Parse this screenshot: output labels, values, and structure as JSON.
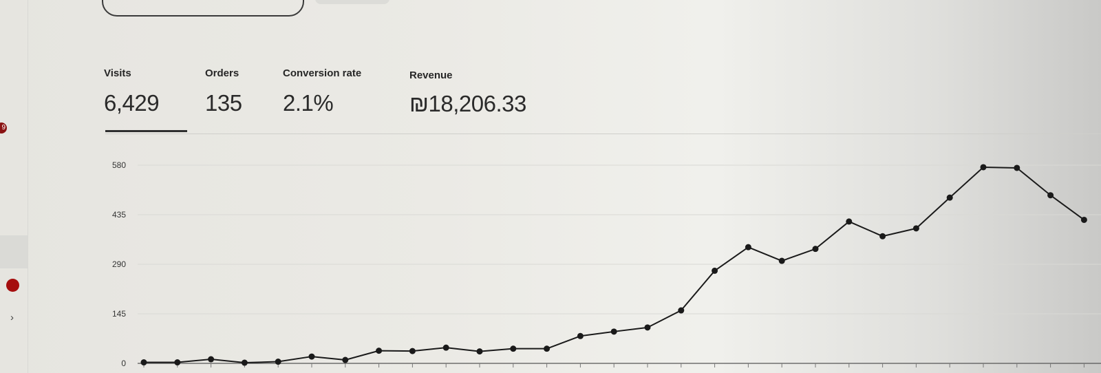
{
  "metrics": {
    "visits": {
      "label": "Visits",
      "value": "6,429"
    },
    "orders": {
      "label": "Orders",
      "value": "135"
    },
    "conversion": {
      "label": "Conversion rate",
      "value": "2.1%"
    },
    "revenue": {
      "label": "Revenue",
      "value": "₪18,206.33"
    }
  },
  "active_tab": "visits",
  "rail": {
    "badge": "9"
  },
  "colors": {
    "line": "#1a1a1a",
    "grid": "#d9d9d5",
    "accent_red": "#a50e0e"
  },
  "chart_data": {
    "type": "line",
    "y_ticks": [
      0,
      145,
      290,
      435,
      580
    ],
    "ylim": [
      0,
      580
    ],
    "grid": true,
    "series": [
      {
        "values": [
          3,
          3,
          12,
          2,
          5,
          20,
          10,
          37,
          36,
          46,
          35,
          43,
          43,
          80,
          93,
          105,
          155,
          271,
          340,
          300,
          335,
          415,
          372,
          395,
          485,
          574,
          572,
          492,
          420
        ]
      }
    ]
  }
}
